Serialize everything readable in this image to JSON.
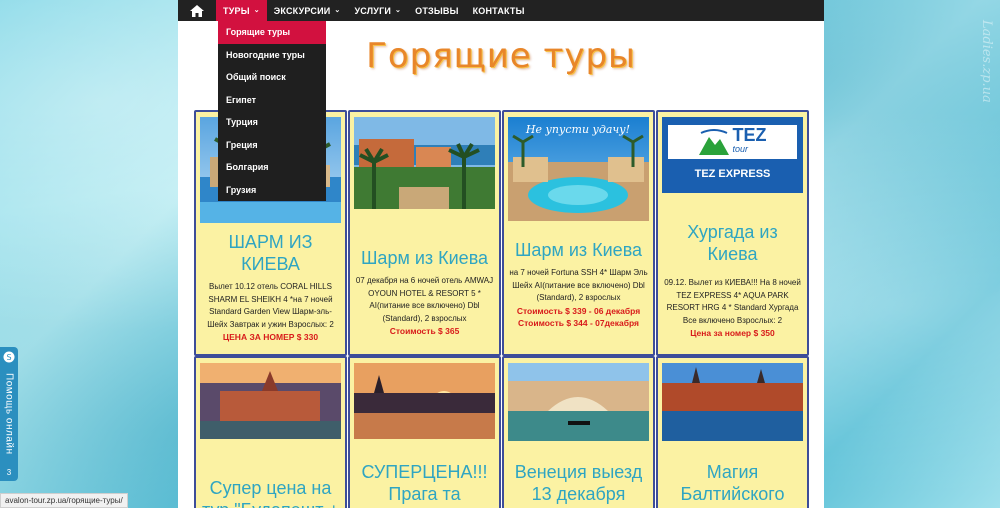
{
  "nav": {
    "items": [
      {
        "label": "ТУРЫ",
        "has_dropdown": true,
        "active": true
      },
      {
        "label": "ЭКСКУРСИИ",
        "has_dropdown": true
      },
      {
        "label": "УСЛУГИ",
        "has_dropdown": true
      },
      {
        "label": "ОТЗЫВЫ"
      },
      {
        "label": "КОНТАКТЫ"
      }
    ],
    "home_icon": "home-icon"
  },
  "dropdown": {
    "items": [
      {
        "label": "Горящие туры",
        "active": true
      },
      {
        "label": "Новогодние туры"
      },
      {
        "label": "Общий поиск"
      },
      {
        "label": "Египет"
      },
      {
        "label": "Турция"
      },
      {
        "label": "Греция"
      },
      {
        "label": "Болгария"
      },
      {
        "label": "Грузия"
      }
    ]
  },
  "page_title": "Горящие туры",
  "cards": [
    {
      "title": "ШАРМ ИЗ КИЕВА",
      "desc": "Вылет 10.12 отель CORAL HILLS SHARM EL SHEIKH 4 *на 7 ночей Standard Garden View Шарм-эль-Шейх Завтрак и ужин Взрослых: 2",
      "prices": [
        "ЦЕНА ЗА НОМЕР $ 330"
      ]
    },
    {
      "title": "Шарм из Киева",
      "desc": "07 декабря на 6 ночей отель AMWAJ OYOUN HOTEL & RESORT 5 * AI(питание все включено) Dbl (Standard), 2 взрослых",
      "prices": [
        "Стоимость $ 365"
      ],
      "price_color": "#d81b1b"
    },
    {
      "title": "Шарм из Киева",
      "desc": "на 7 ночей Fortuna SSH 4* Шарм Эль Шейх AI(питание все включено) Dbl (Standard), 2 взрослых",
      "prices": [
        "Стоимость $ 339 - 06 декабря",
        "Стоимость $ 344 - 07декабря"
      ],
      "banner_text": "Не упусти удачу!"
    },
    {
      "title": "Хургада из Киева",
      "desc": "09.12. Вылет из КИЕВА!!! На 8 ночей TEZ EXPRESS 4* AQUA PARK RESORT HRG 4 * Standard Хургада Все включено Взрослых: 2",
      "prices": [
        "Цена за номер $ 350"
      ],
      "logo_top": "TEZ",
      "logo_sub": "tour",
      "logo_band": "TEZ EXPRESS"
    },
    {
      "title": "Супер цена на тур \"Будапешт +"
    },
    {
      "title": "СУПЕРЦЕНА!!! Прага та"
    },
    {
      "title": "Венеция выезд 13 декабря"
    },
    {
      "title": "Магия Балтийского"
    }
  ],
  "help": {
    "label": "Помощь онлайн",
    "badge": "3"
  },
  "status_url": "avalon-tour.zp.ua/горящие-туры/",
  "watermark": "Ladies.zp.ua",
  "colors": {
    "accent": "#d2113f",
    "nav_bg": "#222222",
    "card_bg": "#fbf2a3",
    "card_border": "#3d4d99",
    "card_title": "#2fa5c2",
    "price": "#d81b1b"
  }
}
